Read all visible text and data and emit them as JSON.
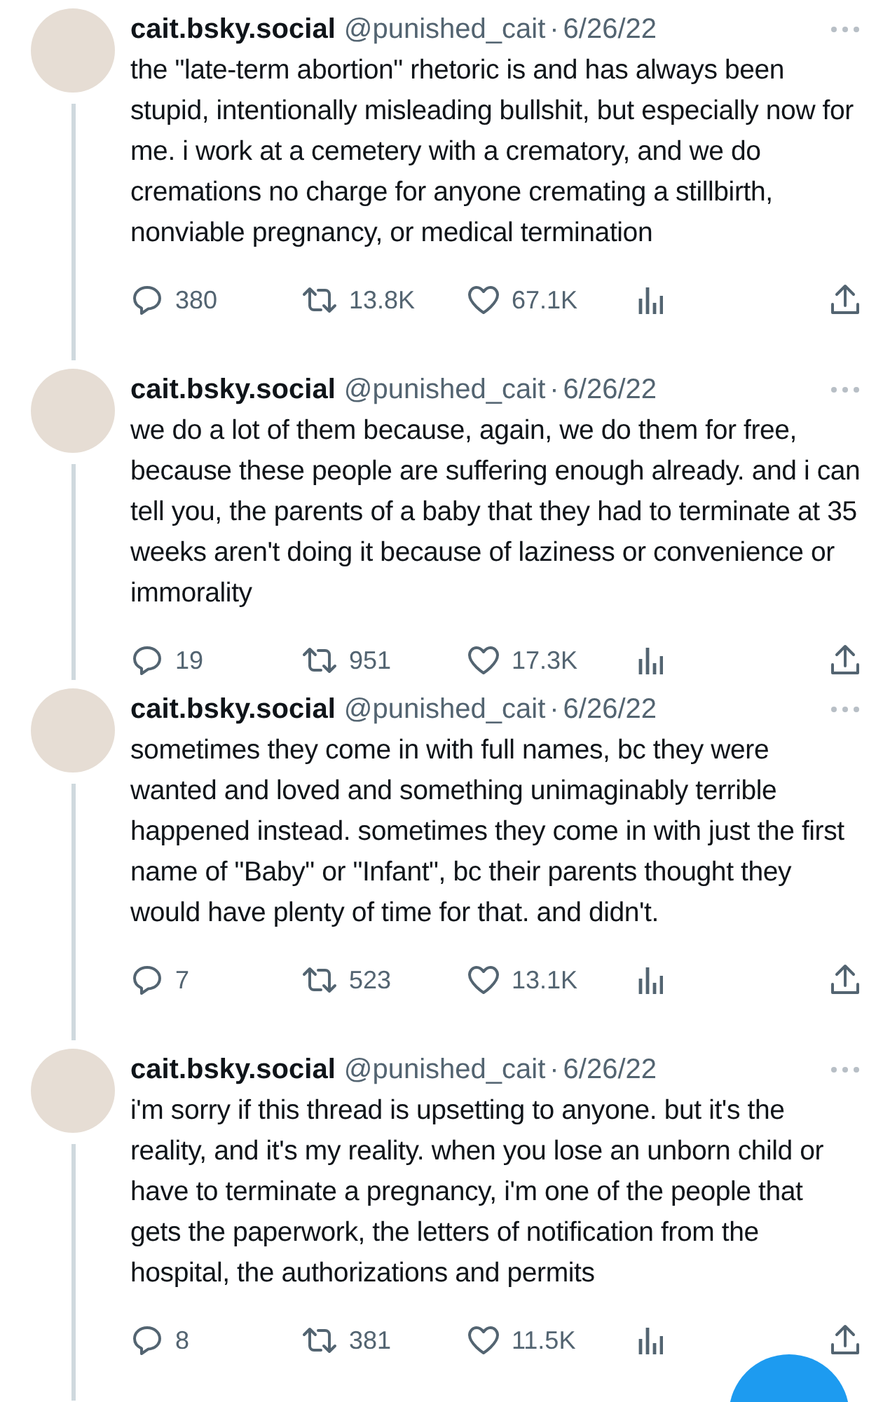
{
  "tweets": [
    {
      "name": "cait.bsky.social",
      "handle": "@punished_cait",
      "separator": "·",
      "date": "6/26/22",
      "text": "the \"late-term abortion\" rhetoric is and has always been stupid, intentionally misleading bullshit, but especially now for me. i work at a cemetery with a crematory, and we do cremations no charge for anyone cremating a stillbirth, nonviable pregnancy, or medical termination",
      "actions": [
        {
          "kind": "reply",
          "count": "380"
        },
        {
          "kind": "repost",
          "count": "13.8K"
        },
        {
          "kind": "like",
          "count": "67.1K"
        },
        {
          "kind": "views"
        },
        {
          "kind": "share"
        }
      ]
    },
    {
      "name": "cait.bsky.social",
      "handle": "@punished_cait",
      "separator": "·",
      "date": "6/26/22",
      "text": "we do a lot of them because, again, we do them for free, because these people are suffering enough already. and i can tell you, the parents of a baby that they had to terminate at 35 weeks aren't doing it because of laziness or convenience or immorality",
      "actions": [
        {
          "kind": "reply",
          "count": "19"
        },
        {
          "kind": "repost",
          "count": "951"
        },
        {
          "kind": "like",
          "count": "17.3K"
        },
        {
          "kind": "views"
        },
        {
          "kind": "share"
        }
      ]
    },
    {
      "name": "cait.bsky.social",
      "handle": "@punished_cait",
      "separator": "·",
      "date": "6/26/22",
      "text": "sometimes they come in with full names, bc they were wanted and loved and something unimaginably terrible happened instead. sometimes they come in with just the first name of \"Baby\" or \"Infant\", bc their parents thought they would have plenty of time for that. and didn't.",
      "actions": [
        {
          "kind": "reply",
          "count": "7"
        },
        {
          "kind": "repost",
          "count": "523"
        },
        {
          "kind": "like",
          "count": "13.1K"
        },
        {
          "kind": "views"
        },
        {
          "kind": "share"
        }
      ]
    },
    {
      "name": "cait.bsky.social",
      "handle": "@punished_cait",
      "separator": "·",
      "date": "6/26/22",
      "text": "i'm sorry if this thread is upsetting to anyone. but it's the reality, and it's my reality. when you lose an unborn child or have to terminate a pregnancy, i'm one of the people that gets the paperwork, the letters of notification from the hospital, the authorizations and permits",
      "actions": [
        {
          "kind": "reply",
          "count": "8"
        },
        {
          "kind": "repost",
          "count": "381"
        },
        {
          "kind": "like",
          "count": "11.5K"
        },
        {
          "kind": "views"
        },
        {
          "kind": "share"
        }
      ]
    }
  ]
}
